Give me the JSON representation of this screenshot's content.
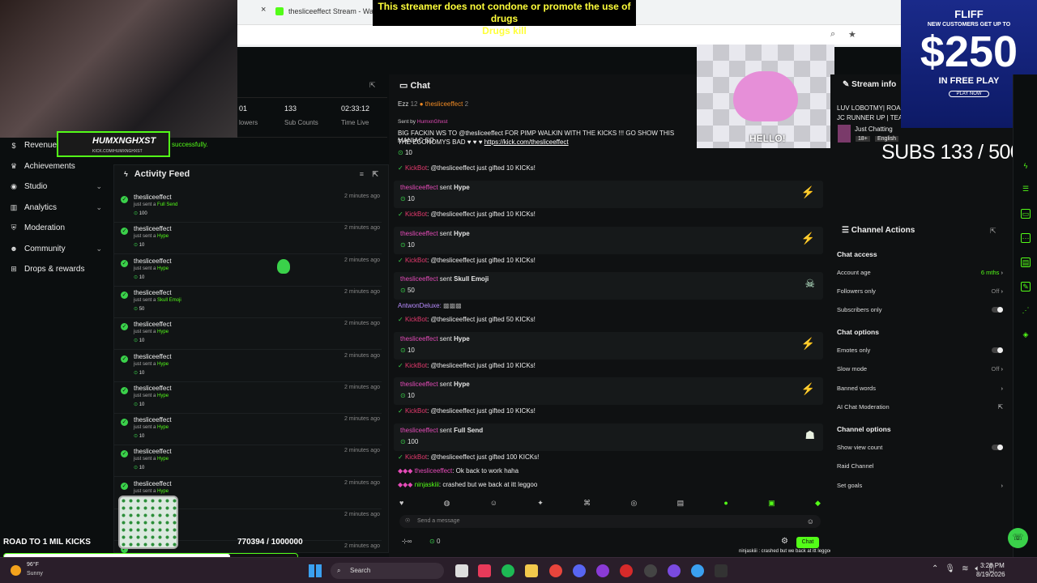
{
  "browser": {
    "tab_title": "thesliceeffect Stream - Wat",
    "tab_close": "×"
  },
  "warning": {
    "line1": "This streamer does not condone or promote the use of drugs",
    "line2": "Drugs kill"
  },
  "stats": [
    {
      "value": "01",
      "label": "lowers"
    },
    {
      "value": "133",
      "label": "Sub Counts"
    },
    {
      "value": "02:33:12",
      "label": "Time Live"
    }
  ],
  "sidebar": {
    "items": [
      {
        "label": "Revenue",
        "icon": "dollar-icon",
        "chevron": false
      },
      {
        "label": "Achievements",
        "icon": "trophy-icon",
        "chevron": false
      },
      {
        "label": "Studio",
        "icon": "studio-icon",
        "chevron": true
      },
      {
        "label": "Analytics",
        "icon": "chart-icon",
        "chevron": true
      },
      {
        "label": "Moderation",
        "icon": "shield-icon",
        "chevron": false
      },
      {
        "label": "Community",
        "icon": "users-icon",
        "chevron": true
      },
      {
        "label": "Drops & rewards",
        "icon": "gift-icon",
        "chevron": false
      }
    ]
  },
  "overlay": {
    "name": "HUMXNGHXST",
    "url": "KICK.COM/HUMXNGHXST",
    "toast": "successfully."
  },
  "activity_feed": {
    "title": "Activity Feed",
    "items": [
      {
        "name": "thesliceeffect",
        "action": "just sent a",
        "item": "Full Send",
        "amount": "100",
        "ago": "2 minutes ago"
      },
      {
        "name": "thesliceeffect",
        "action": "just sent a",
        "item": "Hype",
        "amount": "10",
        "ago": "2 minutes ago"
      },
      {
        "name": "thesliceeffect",
        "action": "just sent a",
        "item": "Hype",
        "amount": "10",
        "ago": "2 minutes ago"
      },
      {
        "name": "thesliceeffect",
        "action": "just sent a",
        "item": "Skull Emoji",
        "amount": "50",
        "ago": "2 minutes ago"
      },
      {
        "name": "thesliceeffect",
        "action": "just sent a",
        "item": "Hype",
        "amount": "10",
        "ago": "2 minutes ago"
      },
      {
        "name": "thesliceeffect",
        "action": "just sent a",
        "item": "Hype",
        "amount": "10",
        "ago": "2 minutes ago"
      },
      {
        "name": "thesliceeffect",
        "action": "just sent a",
        "item": "Hype",
        "amount": "10",
        "ago": "2 minutes ago"
      },
      {
        "name": "thesliceeffect",
        "action": "just sent a",
        "item": "Hype",
        "amount": "10",
        "ago": "2 minutes ago"
      },
      {
        "name": "thesliceeffect",
        "action": "just sent a",
        "item": "Hype",
        "amount": "10",
        "ago": "2 minutes ago"
      },
      {
        "name": "thesliceeffect",
        "action": "just sent a",
        "item": "Hype",
        "amount": "",
        "ago": "2 minutes ago"
      },
      {
        "name": "",
        "action": "",
        "item": "",
        "amount": "",
        "ago": "2 minutes ago"
      },
      {
        "name": "",
        "action": "",
        "item": "",
        "amount": "",
        "ago": "2 minutes ago"
      }
    ]
  },
  "road": {
    "label": "ROAD TO 1 MIL KICKS",
    "count": "770394 / 1000000",
    "progress": 0.770394
  },
  "chat": {
    "title": "Chat",
    "pinned_users": [
      "Ezz",
      "12",
      "thesliceeffect",
      "2"
    ],
    "sent_by": "Sent by",
    "sender": "HumxnGhxst",
    "pinned_message": "BIG FACKIN WS TO @thesliceeffect FOR PIMP WALKIN WITH THE KICKS !!! GO SHOW THIS MANIAC SO",
    "pinned_message2": "THE ECONOMYS BAD",
    "pinned_link": "https://kick.com/thesliceeffect",
    "top_amount": "10",
    "kickbot": "KickBot",
    "gift_text_10": ": @thesliceeffect just gifted 10 KICKs!",
    "gift_text_50": ": @thesliceeffect just gifted 50 KICKs!",
    "gift_text_100": ": @thesliceeffect just gifted 100 KICKs!",
    "sender_name": "thesliceeffect",
    "sent": "sent",
    "hype": "Hype",
    "skull": "Skull Emoji",
    "fullsend": "Full Send",
    "amt10": "10",
    "amt50": "50",
    "amt100": "100",
    "antwon": "AntwonDeluxe:",
    "msg1_user": "thesliceeffect",
    "msg1": ": Ok back to work haha",
    "msg2_user": "ninjaskiii",
    "msg2": ": crashed but we back at itt leggoo",
    "input_placeholder": "Send a message",
    "chat_button": "Chat",
    "viewers": "0"
  },
  "stream_info": {
    "title": "Stream info",
    "desc": "LUV LOBOTMY| ROAD",
    "desc2": "JC RUNNER UP | TEAM",
    "category": "Just Chatting",
    "tags": [
      "18+",
      "English"
    ]
  },
  "subs": "SUBS 133 / 500",
  "hello": "HELLO!",
  "channel_actions": {
    "title": "Channel Actions",
    "chat_access": "Chat access",
    "account_age": "Account age",
    "account_age_val": "6 mths",
    "followers_only": "Followers only",
    "followers_val": "Off",
    "subscribers_only": "Subscribers only",
    "chat_options": "Chat options",
    "emotes_only": "Emotes only",
    "slow_mode": "Slow mode",
    "slow_val": "Off",
    "banned_words": "Banned words",
    "ai_mod": "AI Chat Moderation",
    "channel_options": "Channel options",
    "show_view_count": "Show view count",
    "raid": "Raid Channel",
    "set_goals": "Set goals"
  },
  "ad": {
    "brand": "FLIFF",
    "line1": "NEW CUSTOMERS GET UP TO",
    "amount": "$250",
    "line2": "IN FREE PLAY",
    "cta": "PLAY NOW"
  },
  "taskbar": {
    "temp": "96°F",
    "weather": "Sunny",
    "search": "Search",
    "time": "3:28 PM",
    "date": "8/19/2026"
  },
  "bottom_ticker": "ninjaskiii : crashed but we back at itt leggoo",
  "colors": {
    "kick_green": "#53fc18",
    "kickbot": "#e53a6e",
    "user": "#e54bb8"
  }
}
